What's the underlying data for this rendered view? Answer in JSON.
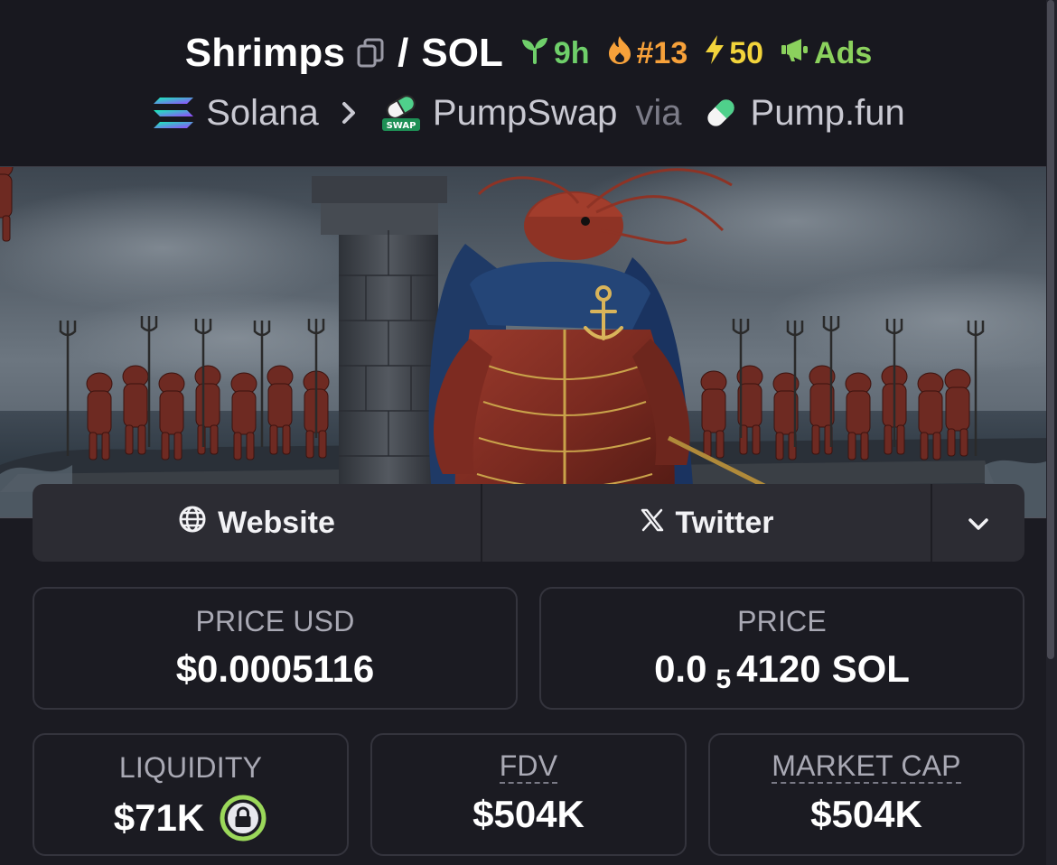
{
  "header": {
    "pair_name": "Shrimps",
    "slash": "/",
    "quote": "SOL",
    "age": "9h",
    "rank": "#13",
    "boosts": "50",
    "ads": "Ads"
  },
  "chain": {
    "chain_name": "Solana",
    "dex_name": "PumpSwap",
    "via": "via",
    "launchpad": "Pump.fun",
    "swap_badge": "SWAP"
  },
  "links": {
    "website": "Website",
    "twitter": "Twitter"
  },
  "stats": {
    "price_usd_label": "PRICE USD",
    "price_usd_value": "$0.0005116",
    "price_label": "PRICE",
    "price_prefix": "0.0",
    "price_zero_count": "5",
    "price_digits": "4120",
    "price_unit": "SOL",
    "liquidity_label": "LIQUIDITY",
    "liquidity_value": "$71K",
    "fdv_label": "FDV",
    "fdv_value": "$504K",
    "mcap_label": "MARKET CAP",
    "mcap_value": "$504K"
  },
  "icons": {
    "copy": "copy-icon",
    "age": "seedling-icon",
    "rank": "flame-icon",
    "boost": "lightning-icon",
    "ads": "megaphone-icon",
    "chain": "solana-logo-icon",
    "breadcrumb_sep": "chevron-right-icon",
    "dex": "pumpswap-logo-icon",
    "launchpad": "pill-icon",
    "website": "globe-icon",
    "twitter": "x-logo-icon",
    "more": "chevron-down-icon",
    "lock": "lock-icon"
  },
  "colors": {
    "background": "#1b1b22",
    "age_green": "#6fcf6a",
    "rank_orange": "#f7a13a",
    "boost_yellow": "#f2d43b",
    "ads_green": "#8bd15d",
    "lock_green": "#9bd85a"
  }
}
